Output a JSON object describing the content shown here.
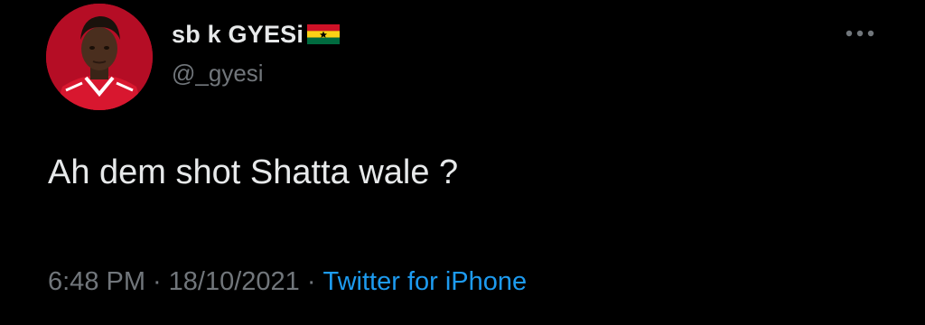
{
  "tweet": {
    "author": {
      "display_name": "sb k GYESi",
      "flag_icon": "ghana-flag-icon",
      "handle": "@_gyesi",
      "avatar_icon": "user-avatar"
    },
    "more_icon": "more-options-icon",
    "text": "Ah dem shot Shatta wale ?",
    "meta": {
      "time": "6:48 PM",
      "separator": "·",
      "date": "18/10/2021",
      "source": "Twitter for iPhone"
    }
  },
  "colors": {
    "background": "#000000",
    "primary_text": "#e7e9ea",
    "secondary_text": "#71767b",
    "link": "#1d9bf0",
    "avatar_jersey": "#c8102e"
  }
}
